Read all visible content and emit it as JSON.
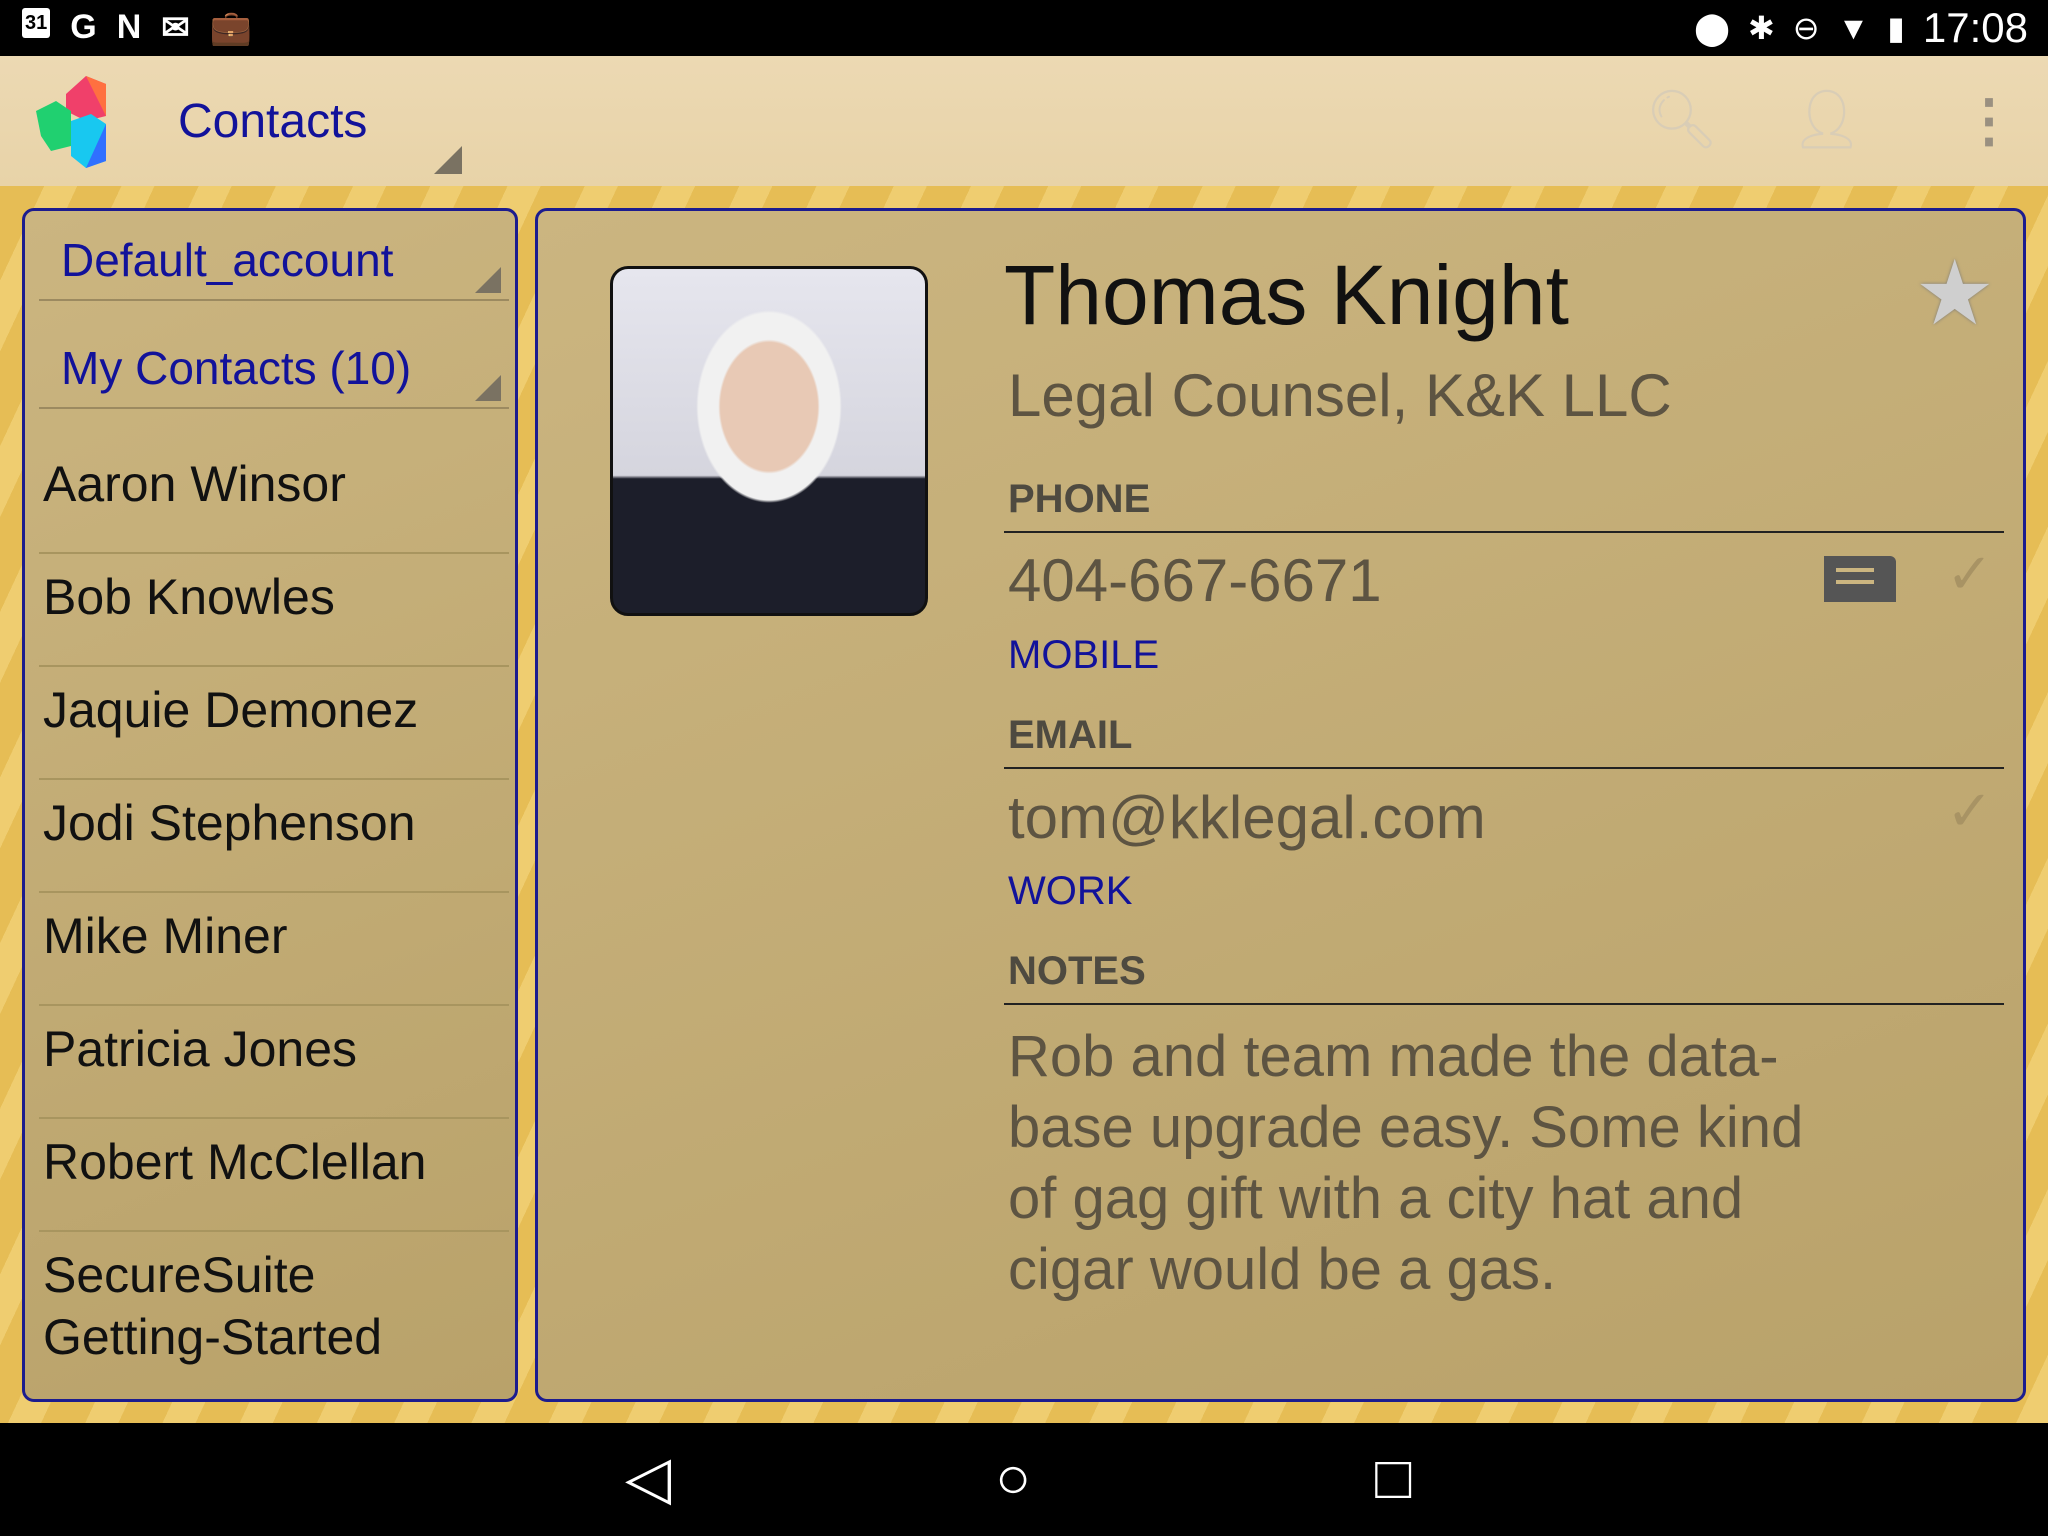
{
  "status": {
    "time": "17:08",
    "icons_left": [
      "calendar-icon",
      "google-icon",
      "n-icon",
      "gmail-icon",
      "briefcase-icon"
    ],
    "icons_right": [
      "location-icon",
      "bluetooth-icon",
      "dnd-icon",
      "wifi-icon",
      "battery-icon"
    ],
    "calendar_day": "31"
  },
  "appbar": {
    "title": "Contacts"
  },
  "sidebar": {
    "account": "Default_account",
    "group": "My Contacts (10)",
    "contacts": [
      "Aaron Winsor",
      "Bob Knowles",
      "Jaquie Demonez",
      "Jodi Stephenson",
      "Mike Miner",
      "Patricia Jones",
      "Robert McClellan",
      "SecureSuite Getting-Started"
    ]
  },
  "contact": {
    "name": "Thomas Knight",
    "title": "Legal Counsel, K&K LLC",
    "phone_label": "PHONE",
    "phone": "404-667-6671",
    "phone_type": "MOBILE",
    "email_label": "EMAIL",
    "email": "tom@kklegal.com",
    "email_type": "WORK",
    "notes_label": "NOTES",
    "notes": "Rob and team made the data-base upgrade easy.  Some kind of gag gift with a city hat and cigar would be a gas."
  },
  "colors": {
    "accent": "#12129a",
    "border": "#1c1c8e"
  }
}
